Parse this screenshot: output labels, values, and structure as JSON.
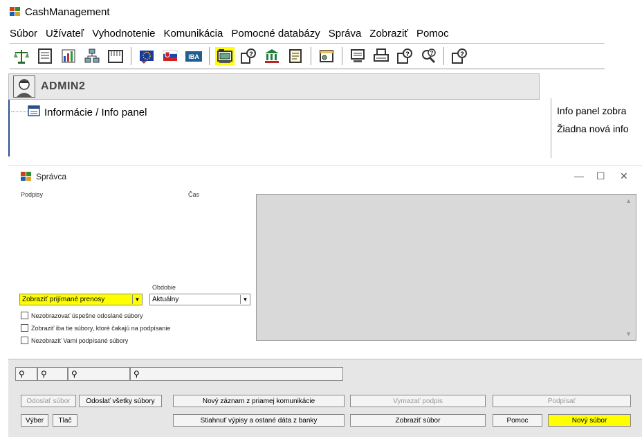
{
  "main_window": {
    "title": "CashManagement",
    "menu": [
      "Súbor",
      "Užívateľ",
      "Vyhodnotenie",
      "Komunikácia",
      "Pomocné databázy",
      "Správa",
      "Zobraziť",
      "Pomoc"
    ],
    "user": "ADMIN2",
    "tree_item": "Informácie / Info panel",
    "info_panel": {
      "line1": "Info panel zobra",
      "line2": "Žiadna nová info"
    },
    "toolbar_icons": [
      "scales-icon",
      "report-icon",
      "chart-icon",
      "org-chart-icon",
      "calendar-icon",
      "eu-flag-icon",
      "sk-flag-icon",
      "iba-icon",
      "highlighted-terminal-icon",
      "network-help-icon",
      "bank-icon",
      "scroll-icon",
      "gear-window-icon",
      "computer-icon",
      "printer-icon",
      "window-help-icon",
      "search-help-icon",
      "help-window-icon"
    ]
  },
  "dialog": {
    "title": "Správca",
    "col_podpisy": "Podpisy",
    "col_cas": "Čas",
    "obdobie_label": "Obdobie",
    "select_prenosy": "Zobraziť prijímané prenosy",
    "select_obdobie": "Aktuálny",
    "checkboxes": [
      "Nezobrazovať úspešne odoslané súbory",
      "Zobraziť iba tie súbory, ktoré čakajú na podpísanie",
      "Nezobraziť Vami podpísané súbory"
    ]
  },
  "buttons": {
    "odoslat_subor": "Odoslať súbor",
    "odoslat_vsetky": "Odoslať všetky súbory",
    "novy_zaznam": "Nový záznam z priamej komunikácie",
    "vymazat_podpis": "Vymazať podpis",
    "podpisat": "Podpísať",
    "vyber": "Výber",
    "tlac": "Tlač",
    "stiahnut": "Stiahnuť výpisy a ostané dáta z banky",
    "zobrazit_subor": "Zobraziť súbor",
    "pomoc": "Pomoc",
    "novy_subor": "Nový súbor"
  },
  "colors": {
    "highlight": "#ffff00",
    "accent": "#2b4e8c"
  }
}
